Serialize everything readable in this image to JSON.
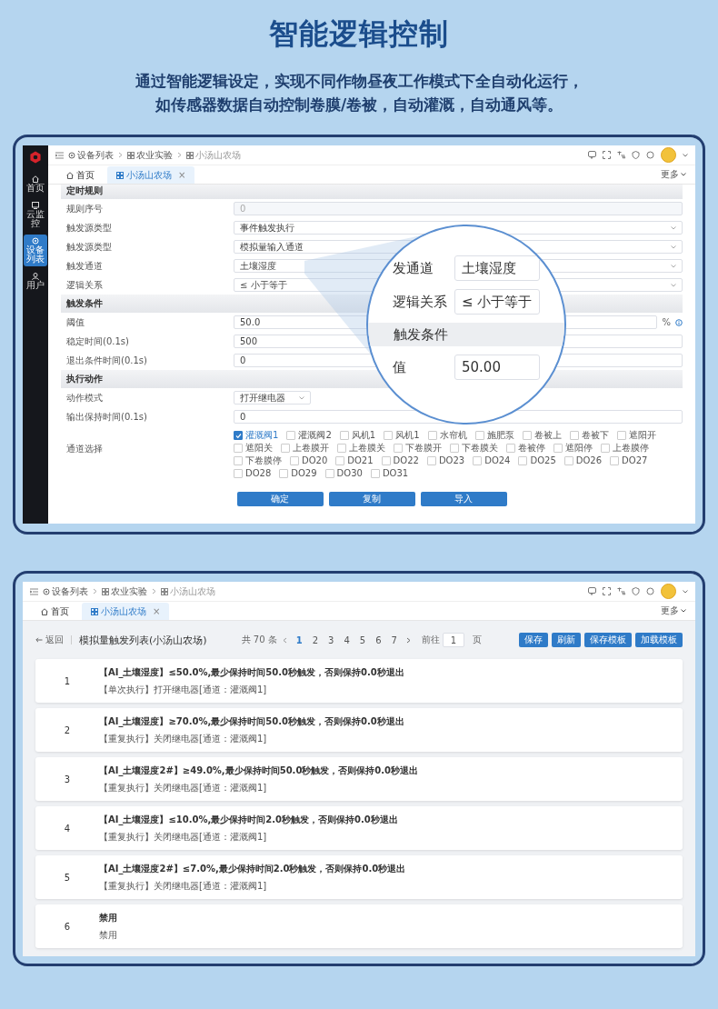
{
  "title": "智能逻辑控制",
  "subtitle_lines": [
    "通过智能逻辑设定，实现不同作物昼夜工作模式下全自动化运行，",
    "如传感器数据自动控制卷膜/卷被，自动灌溉，自动通风等。"
  ],
  "screen_1": {
    "sidebar": [
      {
        "label": "首页",
        "selected": false
      },
      {
        "label": "云监控",
        "selected": false
      },
      {
        "label": "设备列表",
        "selected": true
      },
      {
        "label": "用户",
        "selected": false
      }
    ],
    "breadcrumbs": [
      "设备列表",
      "农业实验",
      "小汤山农场"
    ],
    "tabs": [
      {
        "label": "首页",
        "selected": false
      },
      {
        "label": "小汤山农场",
        "selected": true,
        "close": "×"
      }
    ],
    "more": "更多",
    "form": [
      {
        "kind": "section",
        "label": "定时规则"
      },
      {
        "kind": "input",
        "label": "规则序号",
        "value": "0",
        "disabled": true
      },
      {
        "kind": "select",
        "label": "触发源类型",
        "value": "事件触发执行",
        "disabled": false
      },
      {
        "kind": "select",
        "label": "触发源类型",
        "value": "模拟量输入通道",
        "disabled": false
      },
      {
        "kind": "select",
        "label": "触发通道",
        "value": "土壤湿度",
        "disabled": false
      },
      {
        "kind": "select",
        "label": "逻辑关系",
        "value": "≤ 小于等于",
        "disabled": false
      },
      {
        "kind": "section",
        "label": "触发条件"
      },
      {
        "kind": "input",
        "label": "阈值",
        "value": "50.0",
        "disabled": false,
        "unit": "%",
        "info": true
      },
      {
        "kind": "input",
        "label": "稳定时间(0.1s)",
        "value": "500",
        "disabled": false
      },
      {
        "kind": "input",
        "label": "退出条件时间(0.1s)",
        "value": "0",
        "disabled": false
      },
      {
        "kind": "section",
        "label": "执行动作"
      },
      {
        "kind": "short-select",
        "label": "动作模式",
        "value": "打开继电器",
        "disabled": false
      },
      {
        "kind": "input",
        "label": "输出保持时间(0.1s)",
        "value": "0",
        "disabled": false
      },
      {
        "kind": "checkboxes",
        "label": "通道选择",
        "options": [
          {
            "label": "灌溉阀1",
            "checked": true
          },
          {
            "label": "灌溉阀2",
            "checked": false
          },
          {
            "label": "风机1",
            "checked": false
          },
          {
            "label": "风机1",
            "checked": false
          },
          {
            "label": "水帘机",
            "checked": false
          },
          {
            "label": "施肥泵",
            "checked": false
          },
          {
            "label": "卷被上",
            "checked": false
          },
          {
            "label": "卷被下",
            "checked": false
          },
          {
            "label": "遮阳开",
            "checked": false
          },
          {
            "label": "遮阳关",
            "checked": false
          },
          {
            "label": "上卷膜开",
            "checked": false
          },
          {
            "label": "上卷膜关",
            "checked": false
          },
          {
            "label": "下卷膜开",
            "checked": false
          },
          {
            "label": "下卷膜关",
            "checked": false
          },
          {
            "label": "卷被停",
            "checked": false
          },
          {
            "label": "遮阳停",
            "checked": false
          },
          {
            "label": "上卷膜停",
            "checked": false
          },
          {
            "label": "下卷膜停",
            "checked": false
          },
          {
            "label": "DO20",
            "checked": false
          },
          {
            "label": "DO21",
            "checked": false
          },
          {
            "label": "DO22",
            "checked": false
          },
          {
            "label": "DO23",
            "checked": false
          },
          {
            "label": "DO24",
            "checked": false
          },
          {
            "label": "DO25",
            "checked": false
          },
          {
            "label": "DO26",
            "checked": false
          },
          {
            "label": "DO27",
            "checked": false
          },
          {
            "label": "DO28",
            "checked": false
          },
          {
            "label": "DO29",
            "checked": false
          },
          {
            "label": "DO30",
            "checked": false
          },
          {
            "label": "DO31",
            "checked": false
          }
        ]
      }
    ],
    "buttons": [
      "确定",
      "复制",
      "导入"
    ],
    "magnifier": [
      {
        "kind": "row",
        "label": "发通道",
        "value": "土壤湿度"
      },
      {
        "kind": "row",
        "label": "逻辑关系",
        "value": "≤ 小于等于"
      },
      {
        "kind": "section",
        "label": "触发条件"
      },
      {
        "kind": "row",
        "label": "值",
        "value": "50.00"
      }
    ]
  },
  "screen_2": {
    "breadcrumbs": [
      "设备列表",
      "农业实验",
      "小汤山农场"
    ],
    "tabs": [
      {
        "label": "首页",
        "selected": false
      },
      {
        "label": "小汤山农场",
        "selected": true,
        "close": "×"
      }
    ],
    "more": "更多",
    "back": "返回",
    "list_title": "模拟量触发列表(小汤山农场)",
    "pagination": {
      "total": "共 70 条",
      "pages": [
        {
          "label": "1",
          "selected": true
        },
        {
          "label": "2",
          "selected": false
        },
        {
          "label": "3",
          "selected": false
        },
        {
          "label": "4",
          "selected": false
        },
        {
          "label": "5",
          "selected": false
        },
        {
          "label": "6",
          "selected": false
        },
        {
          "label": "7",
          "selected": false
        }
      ],
      "goto": "前往",
      "page_input": "1",
      "page_unit": "页"
    },
    "buttons": [
      "保存",
      "刷新",
      "保存模板",
      "加载模板"
    ],
    "rules": [
      {
        "index": "1",
        "condition": "【AI_土壤湿度】≤50.0%,最少保持时间50.0秒触发，否则保持0.0秒退出",
        "action": "【单次执行】打开继电器[通道：灌溉阀1]"
      },
      {
        "index": "2",
        "condition": "【AI_土壤湿度】≥70.0%,最少保持时间50.0秒触发，否则保持0.0秒退出",
        "action": "【重复执行】关闭继电器[通道：灌溉阀1]"
      },
      {
        "index": "3",
        "condition": "【AI_土壤湿度2#】≥49.0%,最少保持时间50.0秒触发，否则保持0.0秒退出",
        "action": "【重复执行】关闭继电器[通道：灌溉阀1]"
      },
      {
        "index": "4",
        "condition": "【AI_土壤湿度】≤10.0%,最少保持时间2.0秒触发，否则保持0.0秒退出",
        "action": "【重复执行】关闭继电器[通道：灌溉阀1]"
      },
      {
        "index": "5",
        "condition": "【AI_土壤湿度2#】≤7.0%,最少保持时间2.0秒触发，否则保持0.0秒退出",
        "action": "【重复执行】关闭继电器[通道：灌溉阀1]"
      },
      {
        "index": "6",
        "condition": "禁用",
        "action": "禁用"
      }
    ]
  }
}
